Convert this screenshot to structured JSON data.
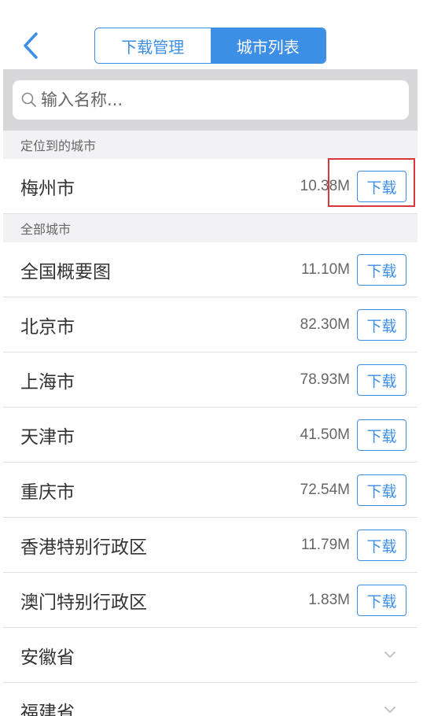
{
  "nav": {
    "tabs": [
      {
        "label": "下载管理",
        "active": false
      },
      {
        "label": "城市列表",
        "active": true
      }
    ]
  },
  "search": {
    "placeholder": "输入名称..."
  },
  "located_section": {
    "header": "定位到的城市",
    "city": {
      "name": "梅州市",
      "size": "10.38M",
      "action": "下载"
    }
  },
  "all_section": {
    "header": "全部城市",
    "cities": [
      {
        "name": "全国概要图",
        "size": "11.10M",
        "action": "下载"
      },
      {
        "name": "北京市",
        "size": "82.30M",
        "action": "下载"
      },
      {
        "name": "上海市",
        "size": "78.93M",
        "action": "下载"
      },
      {
        "name": "天津市",
        "size": "41.50M",
        "action": "下载"
      },
      {
        "name": "重庆市",
        "size": "72.54M",
        "action": "下载"
      },
      {
        "name": "香港特别行政区",
        "size": "11.79M",
        "action": "下载"
      },
      {
        "name": "澳门特别行政区",
        "size": "1.83M",
        "action": "下载"
      }
    ],
    "provinces": [
      {
        "name": "安徽省"
      },
      {
        "name": "福建省"
      }
    ]
  },
  "colors": {
    "accent": "#3d8ee5",
    "highlight": "#d9363e",
    "search_bg": "#d7d7d9",
    "section_bg": "#f2f2f4"
  }
}
